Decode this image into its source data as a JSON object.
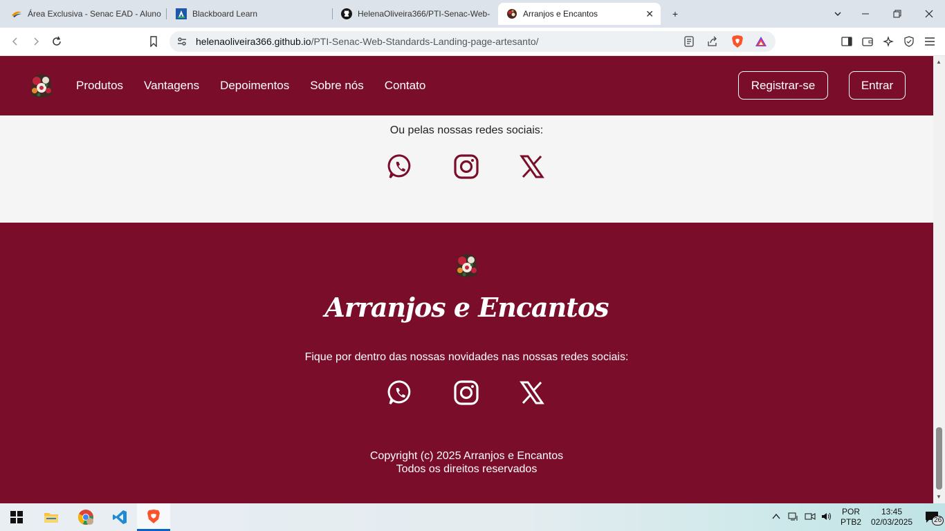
{
  "browser": {
    "tabs": [
      {
        "title": "Área Exclusiva - Senac EAD - Aluno",
        "active": false
      },
      {
        "title": "Blackboard Learn",
        "active": false
      },
      {
        "title": "HelenaOliveira366/PTI-Senac-Web-",
        "active": false
      },
      {
        "title": "Arranjos e Encantos",
        "active": true
      }
    ],
    "new_tab_label": "+",
    "url_host": "helenaoliveira366.github.io",
    "url_path": "/PTI-Senac-Web-Standards-Landing-page-artesanto/"
  },
  "site": {
    "nav": [
      "Produtos",
      "Vantagens",
      "Depoimentos",
      "Sobre nós",
      "Contato"
    ],
    "register_label": "Registrar-se",
    "login_label": "Entrar",
    "social_prompt": "Ou pelas nossas redes sociais:",
    "brand": "Arranjos e Encantos",
    "footer_prompt": "Fique por dentro das nossas novidades nas nossas redes sociais:",
    "copyright_line1": "Copyright (c) 2025 Arranjos e Encantos",
    "copyright_line2": "Todos os direitos reservados",
    "colors": {
      "primary": "#7a0d2a",
      "band": "#f5f5f5"
    },
    "social_icons": [
      "whatsapp-icon",
      "instagram-icon",
      "x-icon"
    ]
  },
  "taskbar": {
    "lang_top": "POR",
    "lang_bottom": "PTB2",
    "time": "13:45",
    "date": "02/03/2025",
    "notifications": "26"
  }
}
